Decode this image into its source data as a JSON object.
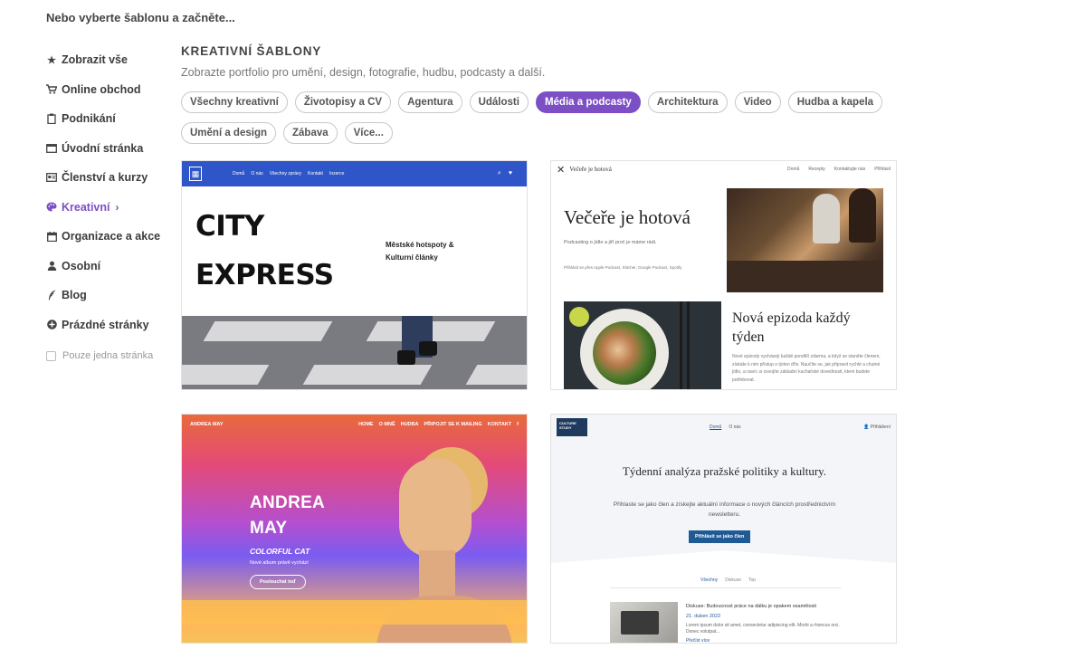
{
  "intro": "Nebo vyberte šablonu a začněte...",
  "sidebar": {
    "items": [
      {
        "label": "Zobrazit vše",
        "icon": "star-icon"
      },
      {
        "label": "Online obchod",
        "icon": "cart-icon"
      },
      {
        "label": "Podnikání",
        "icon": "clipboard-icon"
      },
      {
        "label": "Úvodní stránka",
        "icon": "window-icon"
      },
      {
        "label": "Členství a kurzy",
        "icon": "id-card-icon"
      },
      {
        "label": "Kreativní",
        "icon": "palette-icon",
        "active": true
      },
      {
        "label": "Organizace a akce",
        "icon": "calendar-icon"
      },
      {
        "label": "Osobní",
        "icon": "person-icon"
      },
      {
        "label": "Blog",
        "icon": "quill-icon"
      },
      {
        "label": "Prázdné stránky",
        "icon": "plus-circle-icon"
      }
    ],
    "single_page_label": "Pouze jedna stránka"
  },
  "main": {
    "title": "KREATIVNÍ ŠABLONY",
    "subtitle": "Zobrazte portfolio pro umění, design, fotografie, hudbu, podcasty a další."
  },
  "filters": {
    "row1": [
      "Všechny kreativní",
      "Životopisy a CV",
      "Agentura",
      "Události",
      "Média a podcasty",
      "Architektura",
      "Video",
      "Hudba a kapela"
    ],
    "row2": [
      "Umění a design",
      "Zábava",
      "Více..."
    ],
    "active": "Média a podcasty"
  },
  "templates": {
    "city": {
      "nav": [
        "Domů",
        "O nás",
        "Všechny zprávy",
        "Kontakt",
        "Inzerce"
      ],
      "line1": "CITY",
      "line2": "EXPRESS",
      "tagline1": "Městské hotspoty &",
      "tagline2": "Kulturní články"
    },
    "dinner": {
      "brand": "Večeře je hotová",
      "nav": [
        "Domů",
        "Recepty",
        "Kontaktujte nás",
        "Přihlásit"
      ],
      "title": "Večeře je hotová",
      "desc": "Podcasting o jídle a jiří proč je máme rádi.",
      "listen": "Přihlásit se přes Apple Podcast, Stitcher, Google Podcast, Spotify",
      "episode": "Nová epizoda každý týden",
      "episode_desc": "Nové epizody vycházejí každé pondělí zdarma, a když se staněte členem, získáte k nim přístup o týden dřív. Naučíte se, jak připravit rychlé a chutné jídlo, a navíc si osvojíte základní kuchařské dovednosti, které budete potřebovat."
    },
    "andrea": {
      "brand": "ANDREA MAY",
      "nav": [
        "HOME",
        "O MNĚ",
        "HUDBA",
        "PŘIPOJIT SE K MAILING",
        "KONTAKT"
      ],
      "name1": "ANDREA",
      "name2": "MAY",
      "album": "COLORFUL CAT",
      "album_sub": "Nové album právě vychází",
      "button": "Poslouchat teď"
    },
    "culture": {
      "logo": "CULTURE STUDY",
      "nav": [
        "Domů",
        "O nás"
      ],
      "login": "Přihlášení",
      "headline": "Týdenní analýza pražské politiky a kultury.",
      "sub": "Přihlaste se jako člen a získejte aktuální informace o nových článcích prostřednictvím newsletteru.",
      "cta": "Přihlásit se jako člen",
      "tabs": [
        "Všechny",
        "Diskuse",
        "Top"
      ],
      "article_title": "Diskuse: Budoucnost práce na dálku je opakem osamělosti",
      "article_date": "21. duben 2022",
      "article_text": "Lorem ipsum dolor sit amet, consectetur adipiscing elit. Morbi a rhoncus orci. Donec volutpat...",
      "article_more": "Přečíst více"
    }
  },
  "colors": {
    "accent": "#7c4fc4",
    "city_nav": "#2f56c9",
    "culture_blue": "#1f5a94"
  }
}
